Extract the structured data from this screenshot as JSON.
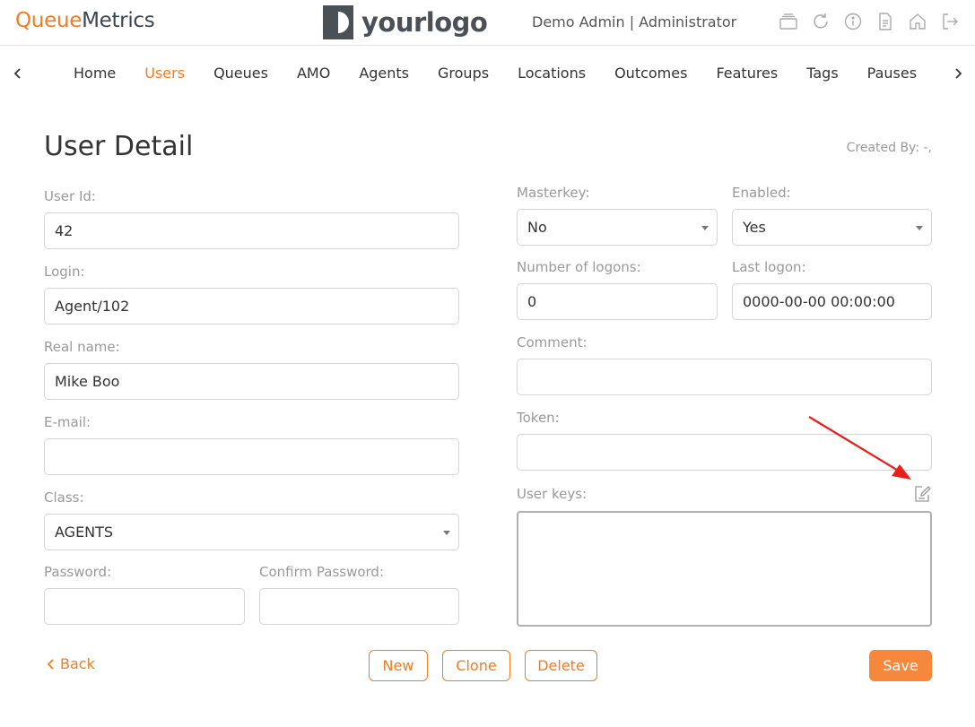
{
  "header": {
    "brand_part1": "Queue",
    "brand_part2": "Metrics",
    "logo_text": "yourlogo",
    "user_info": "Demo Admin | Administrator",
    "icons": [
      "layers-icon",
      "refresh-icon",
      "info-icon",
      "document-icon",
      "home-icon",
      "logout-icon"
    ]
  },
  "nav": {
    "items": [
      "Home",
      "Users",
      "Queues",
      "AMO",
      "Agents",
      "Groups",
      "Locations",
      "Outcomes",
      "Features",
      "Tags",
      "Pauses"
    ],
    "active": "Users"
  },
  "page": {
    "title": "User Detail",
    "created_by": "Created By: -,"
  },
  "form": {
    "user_id": {
      "label": "User Id:",
      "value": "42"
    },
    "login": {
      "label": "Login:",
      "value": "Agent/102"
    },
    "real_name": {
      "label": "Real name:",
      "value": "Mike Boo"
    },
    "email": {
      "label": "E-mail:",
      "value": ""
    },
    "class": {
      "label": "Class:",
      "value": "AGENTS"
    },
    "password": {
      "label": "Password:",
      "value": ""
    },
    "confirm_password": {
      "label": "Confirm Password:",
      "value": ""
    },
    "masterkey": {
      "label": "Masterkey:",
      "value": "No"
    },
    "enabled": {
      "label": "Enabled:",
      "value": "Yes"
    },
    "num_logons": {
      "label": "Number of logons:",
      "value": "0"
    },
    "last_logon": {
      "label": "Last logon:",
      "value": "0000-00-00 00:00:00"
    },
    "comment": {
      "label": "Comment:",
      "value": ""
    },
    "token": {
      "label": "Token:",
      "value": ""
    },
    "user_keys": {
      "label": "User keys:",
      "value": ""
    }
  },
  "actions": {
    "back": "Back",
    "new": "New",
    "clone": "Clone",
    "delete": "Delete",
    "save": "Save"
  },
  "colors": {
    "accent": "#f47b20",
    "annotation": "#e8201c"
  }
}
